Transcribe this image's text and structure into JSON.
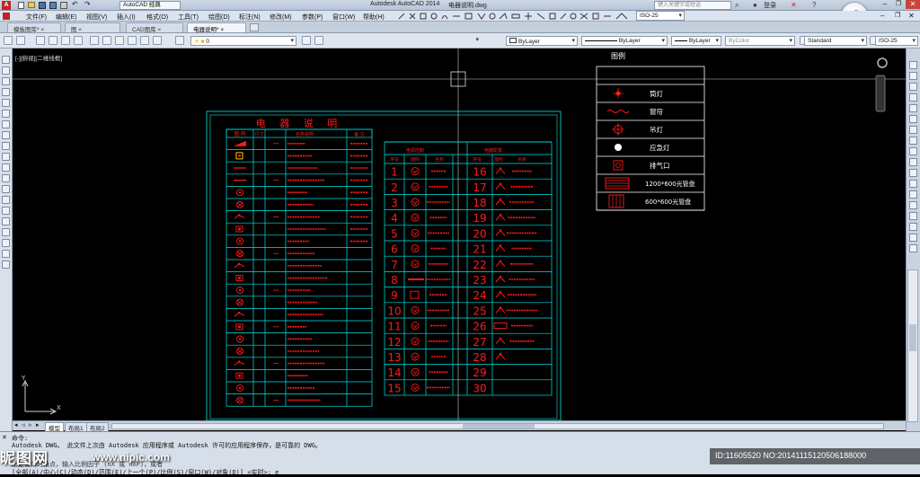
{
  "title_bar": {
    "workspace": "AutoCAD 经典",
    "app_title": "Autodesk AutoCAD 2014",
    "file_name": "电器说明.dwg",
    "search_placeholder": "键入关键字或短语",
    "login": "登录"
  },
  "menu": [
    "文件(F)",
    "编辑(E)",
    "视图(V)",
    "插入(I)",
    "格式(O)",
    "工具(T)",
    "绘图(D)",
    "标注(N)",
    "修改(M)",
    "参数(P)",
    "窗口(W)",
    "帮助(H)"
  ],
  "doc_tabs": [
    {
      "label": "模板图库*",
      "active": false
    },
    {
      "label": "图",
      "active": false
    },
    {
      "label": "CAD图库",
      "active": false
    },
    {
      "label": "电器说明*",
      "active": true
    }
  ],
  "toolbar": {
    "dimstyle_top": "ISO-25",
    "layer": "0",
    "color": "ByLayer",
    "linetype": "ByLayer",
    "lineweight": "ByLayer",
    "plotstyle": "ByColor",
    "text_style": "Standard",
    "dim_style": "ISO-25"
  },
  "viewport_label": "[-][俯视][二维线框]",
  "layout_tabs": [
    {
      "label": "模型",
      "active": true
    },
    {
      "label": "布局1",
      "active": false
    },
    {
      "label": "布局2",
      "active": false
    }
  ],
  "command_lines": [
    "命令:",
    "Autodesk DWG。 此文件上次由 Autodesk 应用程序或 Autodesk 许可的应用程序保存，是可靠的 DWG。",
    "指定窗口的角点，输入比例因子 (nX 或 nXP)，或者",
    "[全部(A)/中心(C)/动态(D)/范围(E)/上一个(P)/比例(S)/窗口(W)/对象(O)] <实时>: e"
  ],
  "watermark": {
    "brand": "昵图网",
    "url": "www.nipic.com",
    "id_text": "ID:11605520 NO:20141115120506188000"
  },
  "drawing": {
    "left_table": {
      "title": "电 器 说 明",
      "headers": [
        "图 例",
        "尺寸",
        "名称说明",
        "备 注"
      ]
    },
    "mid_table": {
      "header_left": "电源控制",
      "header_right": "电器配置",
      "col_headers": [
        "序号",
        "图例",
        "名称",
        "序号",
        "图例",
        "名称"
      ],
      "numbers_left": [
        "1",
        "2",
        "3",
        "4",
        "5",
        "6",
        "7",
        "8",
        "9",
        "10",
        "11",
        "12",
        "13",
        "14",
        "15"
      ],
      "numbers_right": [
        "16",
        "17",
        "18",
        "19",
        "20",
        "21",
        "22",
        "23",
        "24",
        "25",
        "26",
        "27",
        "28",
        "29",
        "30"
      ]
    },
    "legend": {
      "title": "图例",
      "items": [
        "筒灯",
        "窗帘",
        "吊灯",
        "应急灯",
        "排气口",
        "1200*600光管盘",
        "600*600光管盘"
      ]
    }
  },
  "colors": {
    "cad_red": "#ff1a1a",
    "cad_cyan": "#00e5e5",
    "cad_white": "#ffffff",
    "ui_bg": "#dbe3ee"
  }
}
